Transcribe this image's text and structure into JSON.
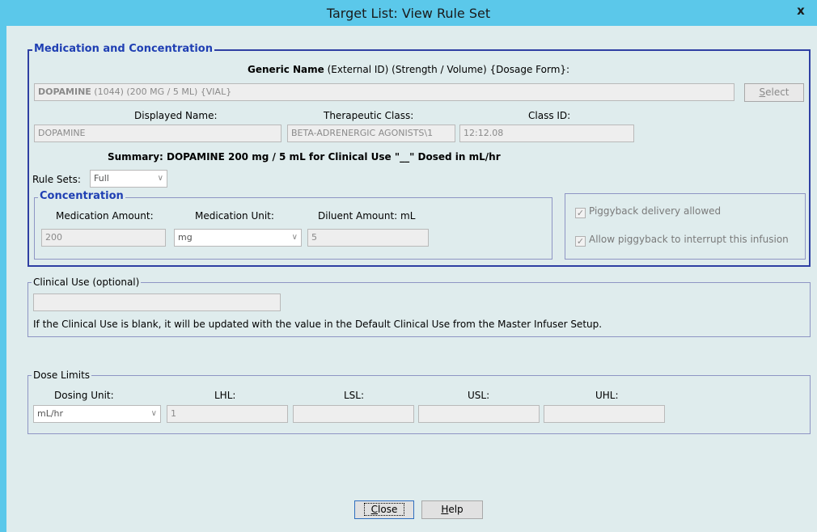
{
  "window": {
    "title": "Target List:  View Rule Set",
    "close_glyph": "x"
  },
  "medication": {
    "legend": "Medication and Concentration",
    "header_bold": "Generic Name",
    "header_rest": " (External ID)  (Strength / Volume)  {Dosage Form}:",
    "generic_name_bold": "DOPAMINE",
    "generic_name_rest": " (1044) (200 MG / 5 ML) {VIAL}",
    "select_label_first": "S",
    "select_label_rest": "elect",
    "displayed_name_label": "Displayed Name:",
    "displayed_name_value": "DOPAMINE",
    "therapeutic_class_label": "Therapeutic Class:",
    "therapeutic_class_value": "BETA-ADRENERGIC AGONISTS\\1",
    "class_id_label": "Class ID:",
    "class_id_value": "12:12.08",
    "summary": "Summary: DOPAMINE 200 mg / 5 mL for Clinical Use \"__\" Dosed in mL/hr",
    "rule_sets_label": "Rule Sets:",
    "rule_sets_value": "Full"
  },
  "concentration": {
    "legend": "Concentration",
    "med_amount_label": "Medication Amount:",
    "med_amount_value": "200",
    "med_unit_label": "Medication Unit:",
    "med_unit_value": "mg",
    "diluent_label": "Diluent Amount: mL",
    "diluent_value": "5"
  },
  "piggyback": {
    "delivery_label": "Piggyback delivery allowed",
    "delivery_checked": true,
    "interrupt_label": "Allow piggyback to interrupt this infusion",
    "interrupt_checked": true
  },
  "clinical_use": {
    "legend": "Clinical Use (optional)",
    "value": "",
    "note": "If the Clinical Use is blank, it will be updated with the value in the Default Clinical Use from the Master Infuser Setup."
  },
  "dose_limits": {
    "legend": "Dose Limits",
    "dosing_unit_label": "Dosing Unit:",
    "dosing_unit_value": "mL/hr",
    "lhl_label": "LHL:",
    "lhl_value": "1",
    "lsl_label": "LSL:",
    "lsl_value": "",
    "usl_label": "USL:",
    "usl_value": "",
    "uhl_label": "UHL:",
    "uhl_value": ""
  },
  "footer": {
    "close_first": "C",
    "close_rest": "lose",
    "help_first": "H",
    "help_rest": "elp"
  },
  "colors": {
    "title_bar": "#5bc8ea",
    "client_bg": "#dfeced",
    "group_border_strong": "#2f3fa3",
    "legend_blue": "#1f3fb3",
    "group_border": "#8e95c4"
  },
  "icons": {
    "dropdown": "chevron-down-icon",
    "check": "checkmark-icon",
    "close": "close-icon"
  }
}
